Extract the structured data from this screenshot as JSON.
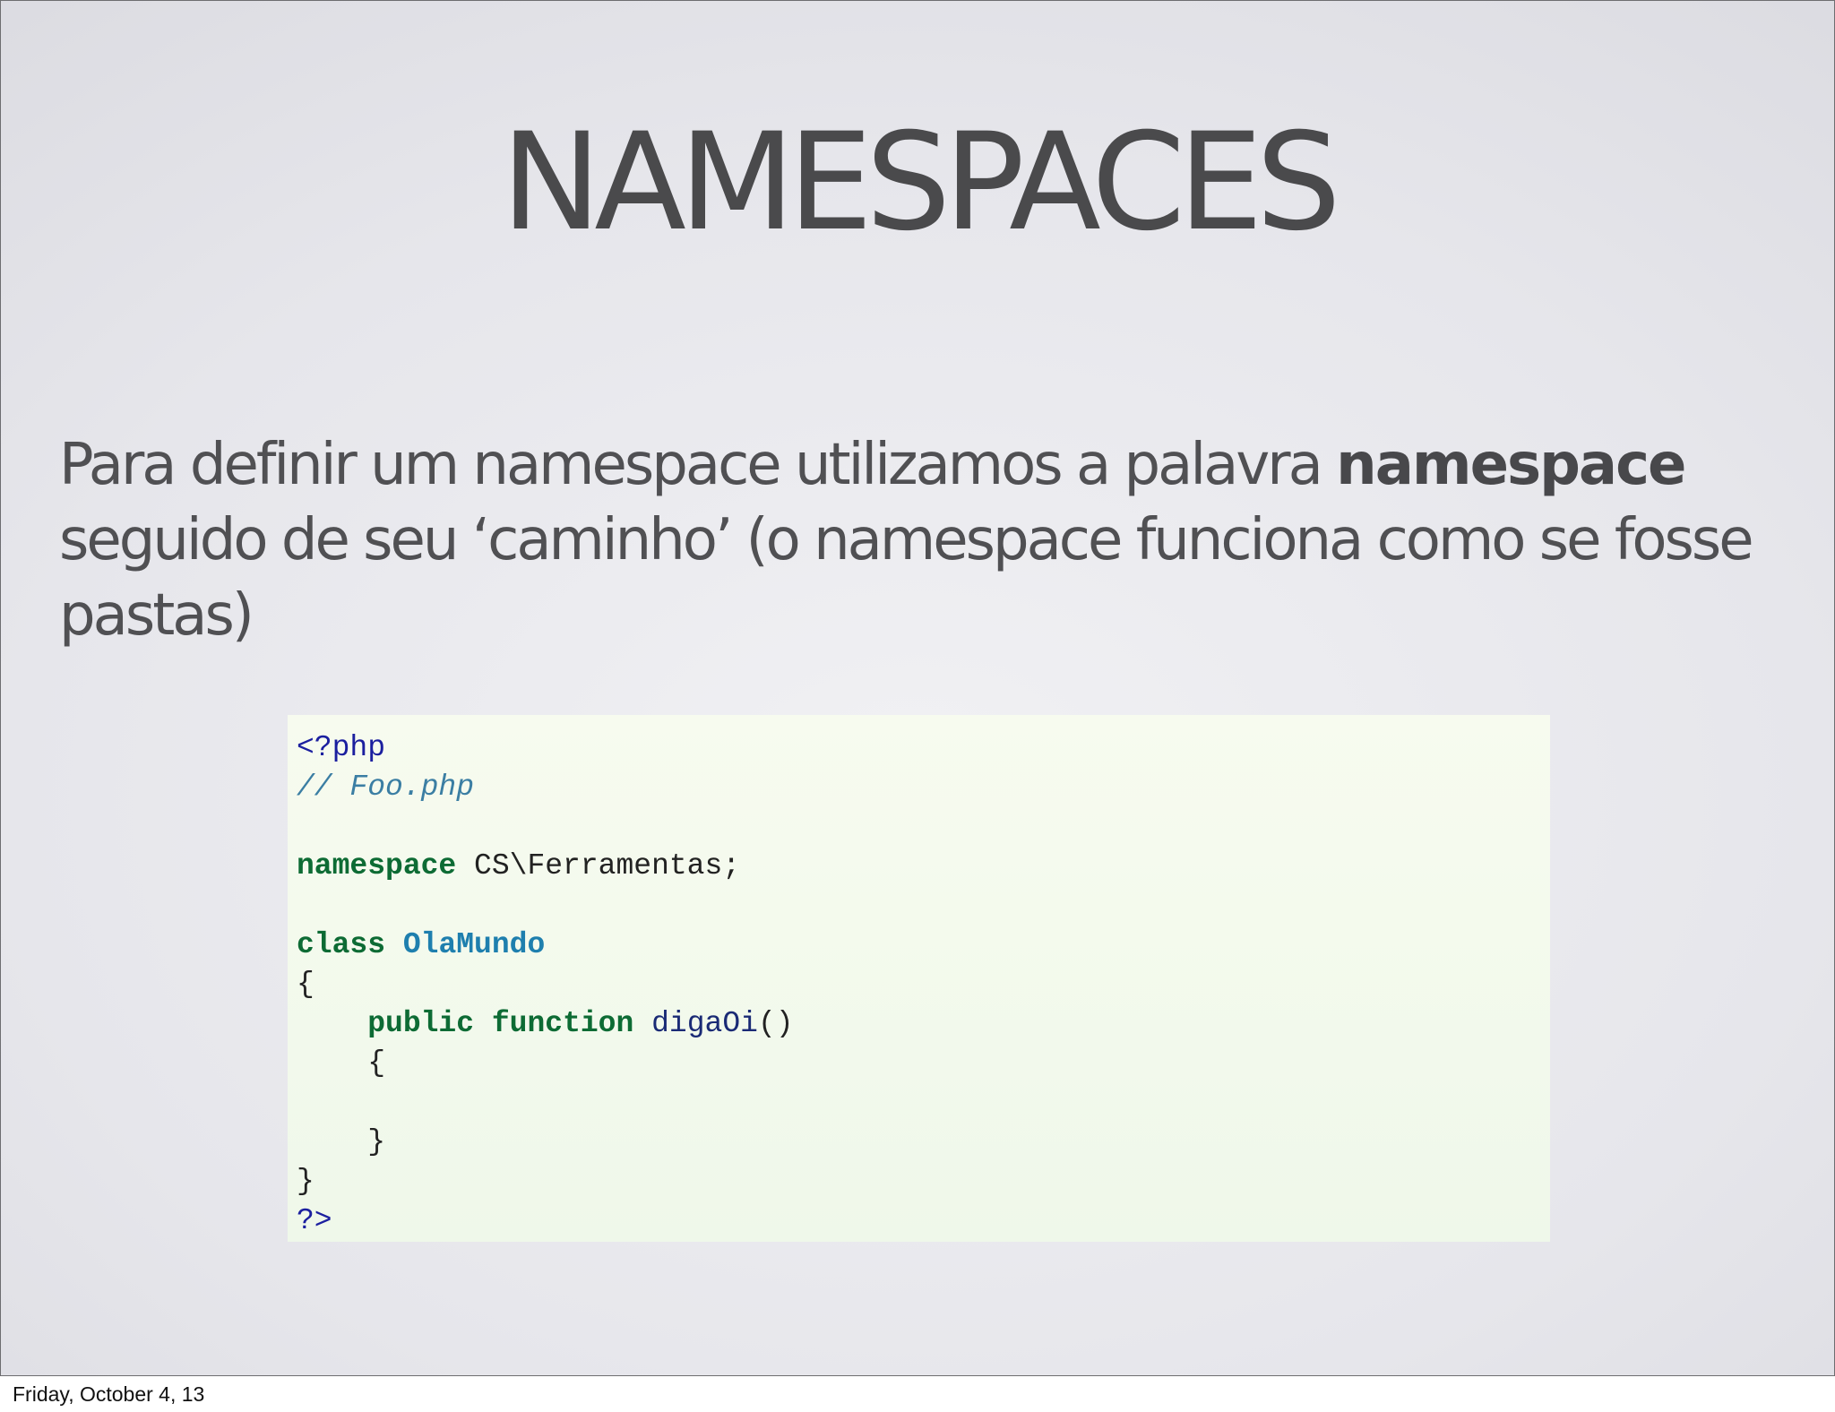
{
  "slide": {
    "title": "NAMESPACES",
    "body": {
      "line1_text": "Para definir um namespace utilizamos a palavra ",
      "line1_keyword": "namespace",
      "line2_text": "seguido de seu ‘caminho’ (o namespace funciona como se fosse",
      "line3_text": "pastas)"
    },
    "code": {
      "open_tag": "<?php",
      "comment": "// Foo.php",
      "ns_keyword": "namespace",
      "ns_path": " CS\\Ferramentas;",
      "class_keyword": "class",
      "class_name": "OlaMundo",
      "brace_open": "{",
      "indent": "    ",
      "public_keyword": "public",
      "function_keyword": "function",
      "method_name": "digaOi",
      "parens": "()",
      "inner_brace_open": "    {",
      "inner_brace_close": "    }",
      "brace_close": "}",
      "close_tag": "?>"
    }
  },
  "footer": {
    "date": "Friday, October 4, 13"
  }
}
